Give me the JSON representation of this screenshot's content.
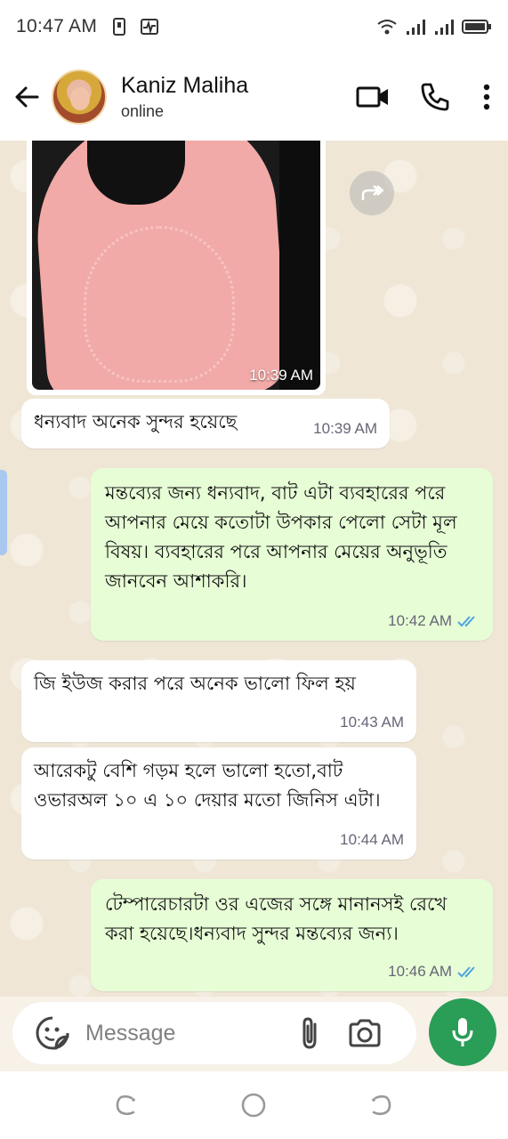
{
  "status_bar": {
    "time": "10:47 AM",
    "icons": [
      "sim-card-icon",
      "activity-icon",
      "wifi-icon",
      "signal-icon",
      "signal-icon",
      "battery-icon"
    ]
  },
  "header": {
    "contact_name": "Kaniz Maliha",
    "contact_status": "online",
    "icons": [
      "back-arrow-icon",
      "video-call-icon",
      "phone-icon",
      "more-vert-icon"
    ]
  },
  "messages": [
    {
      "type": "image",
      "direction": "in",
      "time": "10:39 AM"
    },
    {
      "type": "text",
      "direction": "in",
      "text": "ধন্যবাদ অনেক সুন্দর হয়েছে",
      "time": "10:39 AM"
    },
    {
      "type": "text",
      "direction": "out",
      "text": "মন্তব্যের জন্য ধন্যবাদ, বাট এটা ব্যবহারের পরে আপনার মেয়ে কতোটা উপকার পেলো সেটা মূল বিষয়। ব্যবহারের পরে আপনার মেয়ের অনুভূতি জানবেন আশাকরি।",
      "time": "10:42 AM",
      "read": true
    },
    {
      "type": "text",
      "direction": "in",
      "text": "জি ইউজ করার পরে অনেক ভালো ফিল হয়",
      "time": "10:43 AM"
    },
    {
      "type": "text",
      "direction": "in",
      "text": "আরেকটু বেশি গড়ম হলে ভালো হতো,বাট ওভারঅল ১০ এ ১০ দেয়ার মতো জিনিস এটা।",
      "time": "10:44 AM"
    },
    {
      "type": "text",
      "direction": "out",
      "text": "টেম্পারেচারটা ওর এজের সঙ্গে মানানসই রেখে করা হয়েছে।ধন্যবাদ সুন্দর মন্তব্যের জন্য।",
      "time": "10:46 AM",
      "read": true
    }
  ],
  "composer": {
    "placeholder": "Message",
    "icons": [
      "emoji-sticker-icon",
      "attach-icon",
      "camera-icon",
      "mic-icon"
    ]
  },
  "colors": {
    "outgoing_bubble": "#e7fdd6",
    "incoming_bubble": "#ffffff",
    "read_tick": "#4fa3e0",
    "mic_button": "#2a9d56"
  }
}
